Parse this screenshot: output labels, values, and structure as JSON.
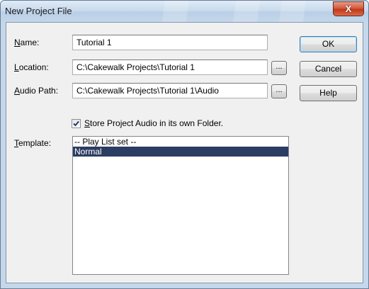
{
  "dialog": {
    "title": "New Project File",
    "close_glyph": "X"
  },
  "form": {
    "name_label_key": "N",
    "name_label_rest": "ame:",
    "name_value": "Tutorial 1",
    "location_label_key": "L",
    "location_label_rest": "ocation:",
    "location_value": "C:\\Cakewalk Projects\\Tutorial 1",
    "audio_path_label_key": "A",
    "audio_path_label_rest": "udio Path:",
    "audio_path_value": "C:\\Cakewalk Projects\\Tutorial 1\\Audio",
    "browse_label": "...",
    "store_audio_key": "S",
    "store_audio_rest": "tore Project Audio in its own Folder.",
    "store_audio_checked": true,
    "template_label_key": "T",
    "template_label_rest": "emplate:",
    "template_items": [
      "-- Play List set --",
      "Normal"
    ],
    "template_selected": "Normal"
  },
  "buttons": {
    "ok": "OK",
    "cancel": "Cancel",
    "help": "Help"
  },
  "colors": {
    "selection": "#2b3d62",
    "close_button": "#c23517"
  }
}
